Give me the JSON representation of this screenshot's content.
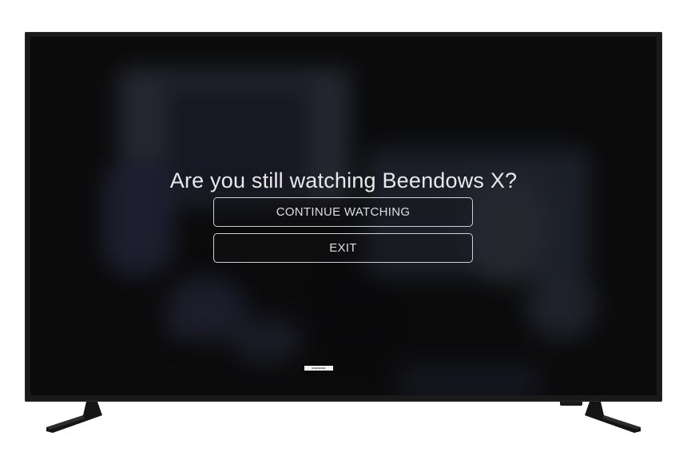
{
  "dialog": {
    "prompt": "Are you still watching Beendows X?",
    "continue_label": "CONTINUE WATCHING",
    "exit_label": "EXIT"
  },
  "tv": {
    "brand": "SAMSUNG"
  },
  "colors": {
    "screen": "#0b0b0c",
    "bezel": "#1a1a1a",
    "text": "#e9e9ec",
    "button_border": "#cfcfd4"
  }
}
